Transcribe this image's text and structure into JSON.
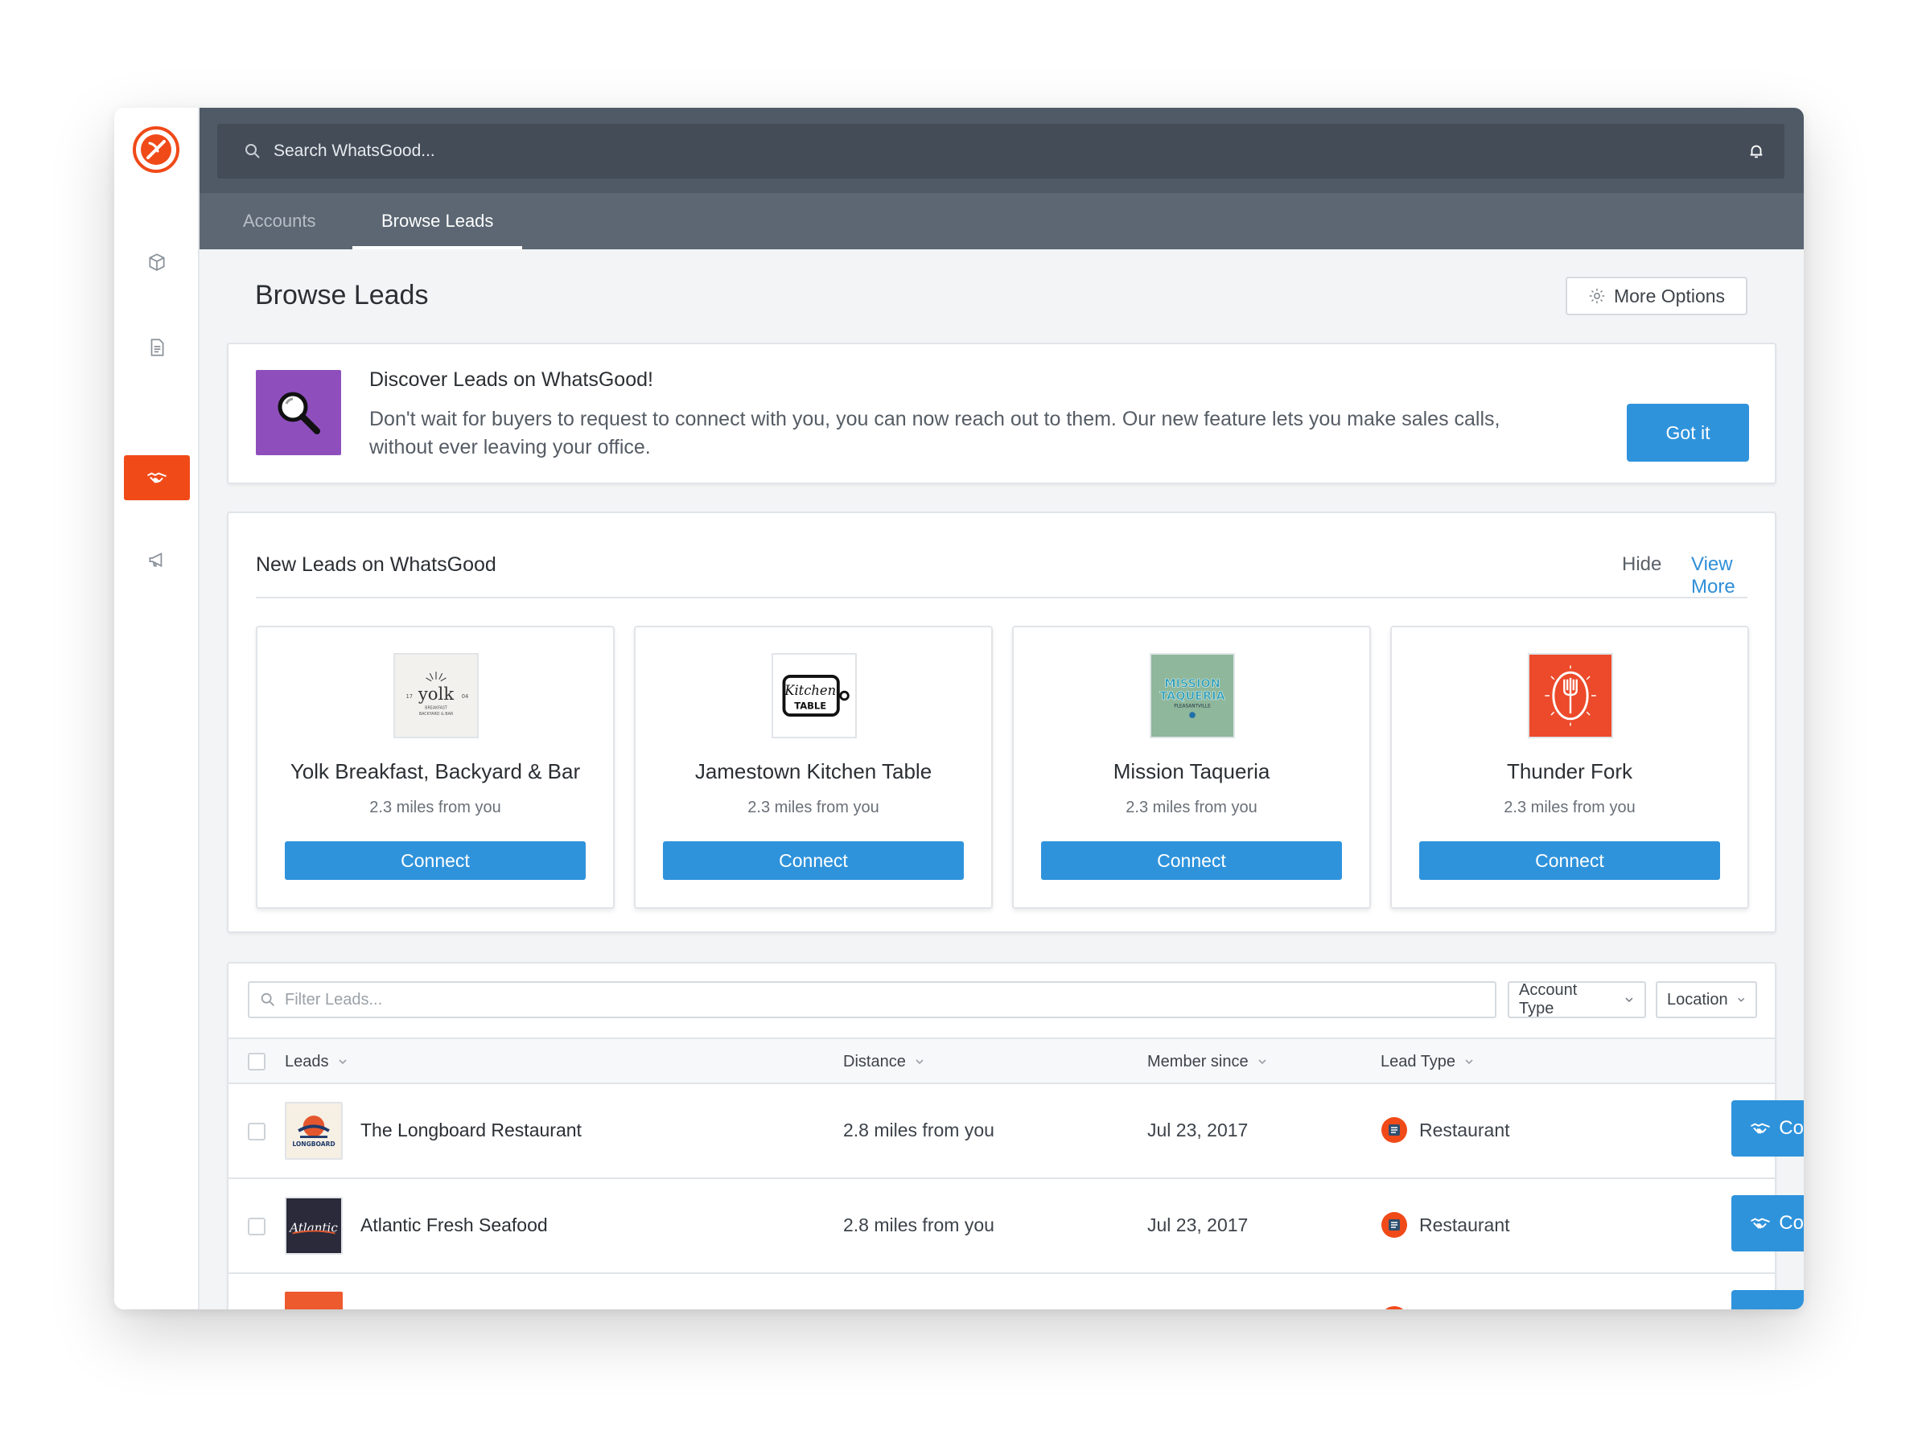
{
  "search": {
    "placeholder": "Search WhatsGood..."
  },
  "tabs": [
    {
      "label": "Accounts"
    },
    {
      "label": "Browse Leads"
    }
  ],
  "page": {
    "title": "Browse Leads",
    "more_options": "More Options"
  },
  "banner": {
    "title": "Discover Leads on WhatsGood!",
    "text": "Don't wait for buyers to request to connect with you, you can now reach out to them. Our new feature lets you make sales calls, without ever leaving your office.",
    "button": "Got it"
  },
  "new_leads": {
    "title": "New Leads on WhatsGood",
    "hide": "Hide",
    "view_more": "View More",
    "cards": [
      {
        "name": "Yolk Breakfast, Backyard & Bar",
        "distance": "2.3 miles from you",
        "button": "Connect",
        "logo_text": "yolk",
        "logo_left": "17",
        "logo_right": "04",
        "logo_sub1": "BREAKFAST",
        "logo_sub2": "BACKYARD & BAR"
      },
      {
        "name": "Jamestown Kitchen Table",
        "distance": "2.3 miles from you",
        "button": "Connect",
        "logo_text1": "Kitchen",
        "logo_text2": "TABLE"
      },
      {
        "name": "Mission Taqueria",
        "distance": "2.3 miles from you",
        "button": "Connect",
        "logo_text1": "MISSION",
        "logo_text2": "TAQUERIA",
        "logo_text3": "PLEASANTVILLE"
      },
      {
        "name": "Thunder Fork",
        "distance": "2.3 miles from you",
        "button": "Connect"
      }
    ]
  },
  "table": {
    "filter_placeholder": "Filter Leads...",
    "account_type": "Account Type",
    "location": "Location",
    "headers": {
      "leads": "Leads",
      "distance": "Distance",
      "member_since": "Member since",
      "lead_type": "Lead Type"
    },
    "rows": [
      {
        "name": "The Longboard Restaurant",
        "distance": "2.8 miles from you",
        "member_since": "Jul 23, 2017",
        "type": "Restaurant",
        "button": "Connect",
        "logo_text": "LONGBOARD"
      },
      {
        "name": "Atlantic Fresh Seafood",
        "distance": "2.8 miles from you",
        "member_since": "Jul 23, 2017",
        "type": "Restaurant",
        "button": "Connect",
        "logo_text": "Atlantic"
      }
    ]
  },
  "colors": {
    "accent": "#f04a19",
    "primary": "#2f93dc",
    "topbar": "#4f5a66"
  }
}
